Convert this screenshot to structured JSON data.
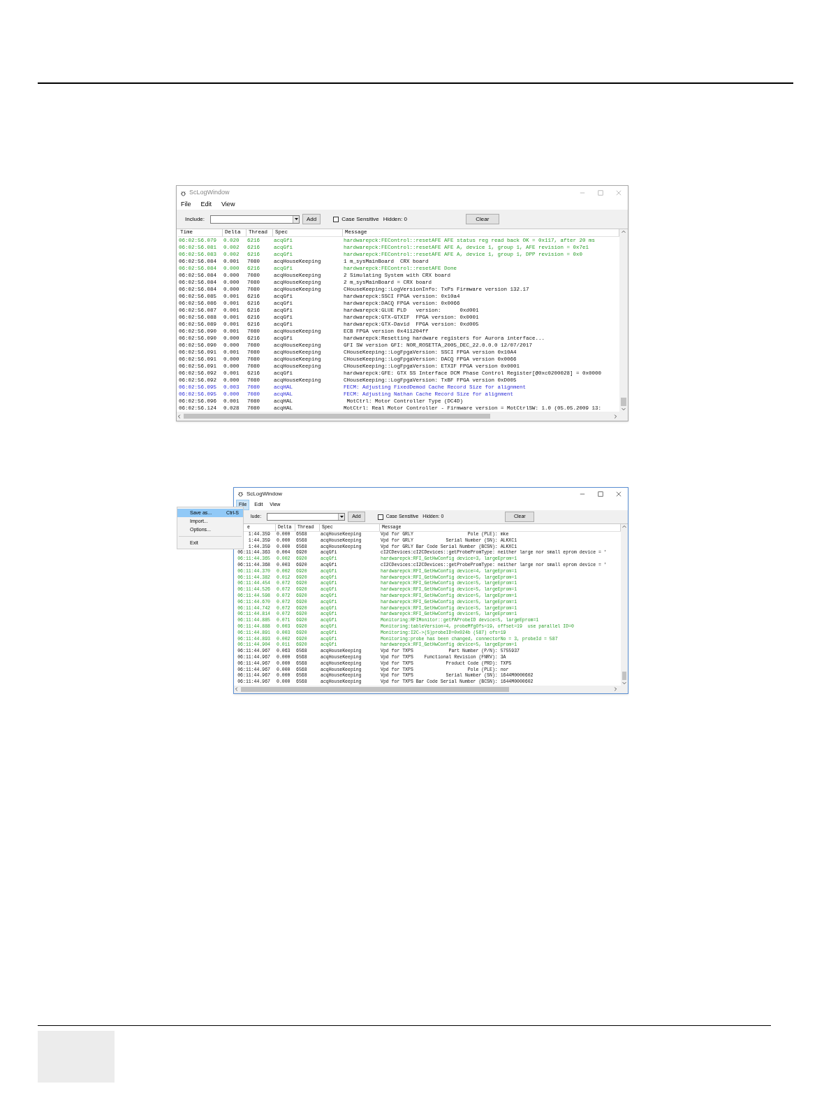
{
  "windows": [
    {
      "title": "ScLogWindow",
      "active": false,
      "menu": [
        {
          "label": "File",
          "selected": false
        },
        {
          "label": "Edit",
          "selected": false
        },
        {
          "label": "View",
          "selected": false
        }
      ],
      "toolbar": {
        "include_label": "Include:",
        "add": "Add",
        "case_sensitive": {
          "label": "Case Sensitive",
          "checked": false
        },
        "hidden": "Hidden: 0",
        "clear": "Clear"
      },
      "columns": [
        "Time",
        "Delta",
        "Thread",
        "Spec",
        "Message"
      ],
      "rows": [
        {
          "time": "06:02:56.079",
          "delta": "0.020",
          "thread": "6216",
          "spec": "acqGfi",
          "message": "hardwarepck:FEControl::resetAFE AFE status reg read back OK = 0x117, after 20 ms",
          "kind": "debug"
        },
        {
          "time": "06:02:56.081",
          "delta": "0.002",
          "thread": "6216",
          "spec": "acqGfi",
          "message": "hardwarepck:FEControl::resetAFE AFE A, device 1, group 1, AFE revision = 0x7e1",
          "kind": "debug"
        },
        {
          "time": "06:02:56.083",
          "delta": "0.002",
          "thread": "6216",
          "spec": "acqGfi",
          "message": "hardwarepck:FEControl::resetAFE AFE A, device 1, group 1, DPP revision = 0x0",
          "kind": "debug"
        },
        {
          "time": "06:02:56.084",
          "delta": "0.001",
          "thread": "7080",
          "spec": "acqHouseKeeping",
          "message": "1 m_sysMainBoard  CRX board",
          "kind": "info"
        },
        {
          "time": "06:02:56.084",
          "delta": "0.000",
          "thread": "6216",
          "spec": "acqGfi",
          "message": "hardwarepck:FEControl::resetAFE Done",
          "kind": "debug"
        },
        {
          "time": "06:02:56.084",
          "delta": "0.000",
          "thread": "7080",
          "spec": "acqHouseKeeping",
          "message": "2 Simulating System with CRX board",
          "kind": "info"
        },
        {
          "time": "06:02:56.084",
          "delta": "0.000",
          "thread": "7080",
          "spec": "acqHouseKeeping",
          "message": "2 m_sysMainBoard = CRX board",
          "kind": "info"
        },
        {
          "time": "06:02:56.084",
          "delta": "0.000",
          "thread": "7080",
          "spec": "acqHouseKeeping",
          "message": "CHouseKeeping::LogVersionInfo: TxPs Firmware version 132.17",
          "kind": "info"
        },
        {
          "time": "06:02:56.085",
          "delta": "0.001",
          "thread": "6216",
          "spec": "acqGfi",
          "message": "hardwarepck:SSCI FPGA version: 0x10a4",
          "kind": "info"
        },
        {
          "time": "06:02:56.086",
          "delta": "0.001",
          "thread": "6216",
          "spec": "acqGfi",
          "message": "hardwarepck:DACQ FPGA version: 0x0066",
          "kind": "info"
        },
        {
          "time": "06:02:56.087",
          "delta": "0.001",
          "thread": "6216",
          "spec": "acqGfi",
          "message": "hardwarepck:GLUE PLD   version:      0xd001",
          "kind": "info"
        },
        {
          "time": "06:02:56.088",
          "delta": "0.001",
          "thread": "6216",
          "spec": "acqGfi",
          "message": "hardwarepck:GTX-GTXIF  FPGA version: 0x0001",
          "kind": "info"
        },
        {
          "time": "06:02:56.089",
          "delta": "0.001",
          "thread": "6216",
          "spec": "acqGfi",
          "message": "hardwarepck:GTX-David  FPGA version: 0xd005",
          "kind": "info"
        },
        {
          "time": "06:02:56.090",
          "delta": "0.001",
          "thread": "7080",
          "spec": "acqHouseKeeping",
          "message": "ECB FPGA version 0x411204ff",
          "kind": "info"
        },
        {
          "time": "06:02:56.090",
          "delta": "0.000",
          "thread": "6216",
          "spec": "acqGfi",
          "message": "hardwarepck:Resetting hardware registers for Aurora interface...",
          "kind": "info"
        },
        {
          "time": "06:02:56.090",
          "delta": "0.000",
          "thread": "7080",
          "spec": "acqHouseKeeping",
          "message": "GFI SW version GFI: NOR_ROSETTA_2005_DEC_22.0.0.0 12/07/2017",
          "kind": "info"
        },
        {
          "time": "06:02:56.091",
          "delta": "0.001",
          "thread": "7080",
          "spec": "acqHouseKeeping",
          "message": "CHouseKeeping::LogFpgaVersion: SSCI FPGA version 0x10A4",
          "kind": "info"
        },
        {
          "time": "06:02:56.091",
          "delta": "0.000",
          "thread": "7080",
          "spec": "acqHouseKeeping",
          "message": "CHouseKeeping::LogFpgaVersion: DACQ FPGA version 0x0066",
          "kind": "info"
        },
        {
          "time": "06:02:56.091",
          "delta": "0.000",
          "thread": "7080",
          "spec": "acqHouseKeeping",
          "message": "CHouseKeeping::LogFpgaVersion: ETXIF FPGA version 0x0001",
          "kind": "info"
        },
        {
          "time": "06:02:56.092",
          "delta": "0.001",
          "thread": "6216",
          "spec": "acqGfi",
          "message": "hardwarepck:GFE: GTX SS Interface DCM Phase Control Register[@0xc0200028] = 0x0000",
          "kind": "info"
        },
        {
          "time": "06:02:56.092",
          "delta": "0.000",
          "thread": "7080",
          "spec": "acqHouseKeeping",
          "message": "CHouseKeeping::LogFpgaVersion: TxBF FPGA version 0xD005",
          "kind": "info"
        },
        {
          "time": "06:02:56.095",
          "delta": "0.003",
          "thread": "7080",
          "spec": "acqHAL",
          "message": "FECM: Adjusting FixedDemod Cache Record Size for alignment",
          "kind": "trace"
        },
        {
          "time": "06:02:56.095",
          "delta": "0.000",
          "thread": "7080",
          "spec": "acqHAL",
          "message": "FECM: Adjusting Nathan Cache Record Size for alignment",
          "kind": "trace"
        },
        {
          "time": "06:02:56.096",
          "delta": "0.001",
          "thread": "7080",
          "spec": "acqHAL",
          "message": " MotCtrl: Motor Controller Type (DC4D)",
          "kind": "info"
        },
        {
          "time": "06:02:56.124",
          "delta": "0.028",
          "thread": "7080",
          "spec": "acqHAL",
          "message": "MotCtrl: Real Motor Controller - Firmware version = MotCtrlSW: 1.0 (05.05.2009 13:",
          "kind": "info"
        }
      ]
    },
    {
      "title": "ScLogWindow",
      "active": true,
      "menu": [
        {
          "label": "File",
          "selected": true
        },
        {
          "label": "Edit",
          "selected": false
        },
        {
          "label": "View",
          "selected": false
        }
      ],
      "file_menu": [
        {
          "label": "Save as...",
          "shortcut": "Ctrl-S",
          "selected": true
        },
        {
          "label": "Import...",
          "selected": false
        },
        {
          "label": "Options...",
          "selected": false
        },
        {
          "label": "Exit",
          "selected": false
        }
      ],
      "toolbar": {
        "include_label": "lude:",
        "add": "Add",
        "case_sensitive": {
          "label": "Case Sensitive",
          "checked": false
        },
        "hidden": "Hidden: 0",
        "clear": "Clear"
      },
      "columns": [
        "e",
        "Delta",
        "Thread",
        "Spec",
        "Message"
      ],
      "rows": [
        {
          "time": "1:44.359",
          "delta": "0.000",
          "thread": "6568",
          "spec": "acqHouseKeeping",
          "message": "Vpd for GRLY                    Pole (PLE): mke",
          "kind": "info"
        },
        {
          "time": "1:44.359",
          "delta": "0.000",
          "thread": "6568",
          "spec": "acqHouseKeeping",
          "message": "Vpd for GRLY            Serial Number (SN): ALKXC1",
          "kind": "info"
        },
        {
          "time": "1:44.359",
          "delta": "0.000",
          "thread": "6568",
          "spec": "acqHouseKeeping",
          "message": "Vpd for GRLY Bar Code Serial Number (BCSN): ALKXC1",
          "kind": "info"
        },
        {
          "time": "06:11:44.363",
          "delta": "0.004",
          "thread": "6920",
          "spec": "acqGfi",
          "message": "cI2CDevices:cI2CDevices::getProbePromType: neither large nor small eprom device = '",
          "kind": "info"
        },
        {
          "time": "06:11:44.365",
          "delta": "0.002",
          "thread": "6920",
          "spec": "acqGfi",
          "message": "hardwarepck:RFI_GetHwConfig device=3, largeEprom=1",
          "kind": "debug"
        },
        {
          "time": "06:11:44.368",
          "delta": "0.003",
          "thread": "6920",
          "spec": "acqGfi",
          "message": "cI2CDevices:cI2CDevices::getProbePromType: neither large nor small eprom device = '",
          "kind": "info"
        },
        {
          "time": "06:11:44.370",
          "delta": "0.002",
          "thread": "6920",
          "spec": "acqGfi",
          "message": "hardwarepck:RFI_GetHwConfig device=4, largeEprom=1",
          "kind": "debug"
        },
        {
          "time": "06:11:44.382",
          "delta": "0.012",
          "thread": "6920",
          "spec": "acqGfi",
          "message": "hardwarepck:RFI_GetHwConfig device=5, largeEprom=1",
          "kind": "debug"
        },
        {
          "time": "06:11:44.454",
          "delta": "0.072",
          "thread": "6920",
          "spec": "acqGfi",
          "message": "hardwarepck:RFI_GetHwConfig device=5, largeEprom=1",
          "kind": "debug"
        },
        {
          "time": "06:11:44.526",
          "delta": "0.072",
          "thread": "6920",
          "spec": "acqGfi",
          "message": "hardwarepck:RFI_GetHwConfig device=5, largeEprom=1",
          "kind": "debug"
        },
        {
          "time": "06:11:44.598",
          "delta": "0.072",
          "thread": "6920",
          "spec": "acqGfi",
          "message": "hardwarepck:RFI_GetHwConfig device=5, largeEprom=1",
          "kind": "debug"
        },
        {
          "time": "06:11:44.670",
          "delta": "0.072",
          "thread": "6920",
          "spec": "acqGfi",
          "message": "hardwarepck:RFI_GetHwConfig device=5, largeEprom=1",
          "kind": "debug"
        },
        {
          "time": "06:11:44.742",
          "delta": "0.072",
          "thread": "6920",
          "spec": "acqGfi",
          "message": "hardwarepck:RFI_GetHwConfig device=5, largeEprom=1",
          "kind": "debug"
        },
        {
          "time": "06:11:44.814",
          "delta": "0.072",
          "thread": "6920",
          "spec": "acqGfi",
          "message": "hardwarepck:RFI_GetHwConfig device=5, largeEprom=1",
          "kind": "debug"
        },
        {
          "time": "06:11:44.885",
          "delta": "0.071",
          "thread": "6920",
          "spec": "acqGfi",
          "message": "Monitoring:RFIMonitor::getPAProbeID device=5, largeEprom=1",
          "kind": "debug"
        },
        {
          "time": "06:11:44.888",
          "delta": "0.003",
          "thread": "6920",
          "spec": "acqGfi",
          "message": "Monitoring:tableVersion=4, probeMfgOfs=19, offset=19  use parallel ID=0",
          "kind": "debug"
        },
        {
          "time": "06:11:44.891",
          "delta": "0.003",
          "thread": "6920",
          "spec": "acqGfi",
          "message": "Monitoring:I2C->(S)probeID=0x024b (587) ofs=19",
          "kind": "debug"
        },
        {
          "time": "06:11:44.893",
          "delta": "0.002",
          "thread": "6920",
          "spec": "acqGfi",
          "message": "Monitoring:probe has been changed, connectorNo = 3, probeId = 587",
          "kind": "debug"
        },
        {
          "time": "06:11:44.904",
          "delta": "0.011",
          "thread": "6920",
          "spec": "acqGfi",
          "message": "hardwarepck:RFI_GetHwConfig device=5, largeEprom=1",
          "kind": "debug"
        },
        {
          "time": "06:11:44.967",
          "delta": "0.063",
          "thread": "6568",
          "spec": "acqHouseKeeping",
          "message": "Vpd for TXPS             Part Number (P/N): 5755937",
          "kind": "info"
        },
        {
          "time": "06:11:44.967",
          "delta": "0.000",
          "thread": "6568",
          "spec": "acqHouseKeeping",
          "message": "Vpd for TXPS    Functional Revision (FNRV): 3A",
          "kind": "info"
        },
        {
          "time": "06:11:44.967",
          "delta": "0.000",
          "thread": "6568",
          "spec": "acqHouseKeeping",
          "message": "Vpd for TXPS            Product Code (PRD): TXPS",
          "kind": "info"
        },
        {
          "time": "06:11:44.967",
          "delta": "0.000",
          "thread": "6568",
          "spec": "acqHouseKeeping",
          "message": "Vpd for TXPS                    Pole (PLE): nor",
          "kind": "info"
        },
        {
          "time": "06:11:44.967",
          "delta": "0.000",
          "thread": "6568",
          "spec": "acqHouseKeeping",
          "message": "Vpd for TXPS            Serial Number (SN): 1644M0000602",
          "kind": "info"
        },
        {
          "time": "06:11:44.967",
          "delta": "0.000",
          "thread": "6568",
          "spec": "acqHouseKeeping",
          "message": "Vpd for TXPS Bar Code Serial Number (BCSN): 1644M0000602",
          "kind": "info"
        }
      ]
    }
  ]
}
